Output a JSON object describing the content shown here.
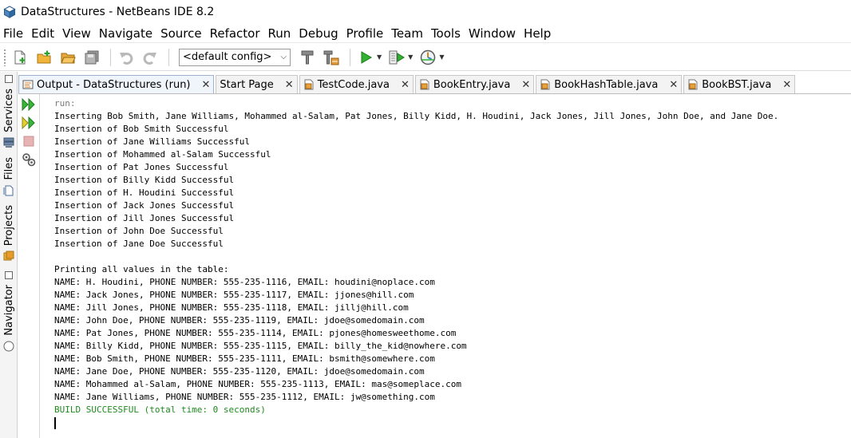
{
  "window": {
    "title": "DataStructures - NetBeans IDE 8.2",
    "app_icon": "netbeans-cube-icon"
  },
  "menubar": {
    "items": [
      "File",
      "Edit",
      "View",
      "Navigate",
      "Source",
      "Refactor",
      "Run",
      "Debug",
      "Profile",
      "Team",
      "Tools",
      "Window",
      "Help"
    ]
  },
  "toolbar": {
    "icons": [
      "new-file-icon",
      "new-project-icon",
      "open-project-icon",
      "save-all-icon",
      "undo-icon",
      "redo-icon",
      "clean-build-icon",
      "build-icon",
      "run-icon",
      "debug-icon",
      "profile-icon"
    ],
    "config_value": "<default config>"
  },
  "left_sidebar": {
    "tabs": [
      "Services",
      "Files",
      "Projects",
      "Navigator"
    ]
  },
  "tabs": [
    {
      "label": "Output - DataStructures (run)",
      "icon": "output-icon",
      "active": true
    },
    {
      "label": "Start Page",
      "icon": "",
      "active": false
    },
    {
      "label": "TestCode.java",
      "icon": "java-file-icon",
      "active": false
    },
    {
      "label": "BookEntry.java",
      "icon": "java-file-icon",
      "active": false
    },
    {
      "label": "BookHashTable.java",
      "icon": "java-file-icon",
      "active": false
    },
    {
      "label": "BookBST.java",
      "icon": "java-file-icon",
      "active": false
    }
  ],
  "output_actions": [
    "rerun-icon",
    "rerun-with-options-icon",
    "stop-icon",
    "settings-icon"
  ],
  "output": {
    "lines": [
      {
        "text": "run:",
        "style": "run"
      },
      {
        "text": "Inserting Bob Smith, Jane Williams, Mohammed al-Salam, Pat Jones, Billy Kidd, H. Houdini, Jack Jones, Jill Jones, John Doe, and Jane Doe.",
        "style": "normal"
      },
      {
        "text": "Insertion of Bob Smith Successful",
        "style": "normal"
      },
      {
        "text": "Insertion of Jane Williams Successful",
        "style": "normal"
      },
      {
        "text": "Insertion of Mohammed al-Salam Successful",
        "style": "normal"
      },
      {
        "text": "Insertion of Pat Jones Successful",
        "style": "normal"
      },
      {
        "text": "Insertion of Billy Kidd Successful",
        "style": "normal"
      },
      {
        "text": "Insertion of H. Houdini Successful",
        "style": "normal"
      },
      {
        "text": "Insertion of Jack Jones Successful",
        "style": "normal"
      },
      {
        "text": "Insertion of Jill Jones Successful",
        "style": "normal"
      },
      {
        "text": "Insertion of John Doe Successful",
        "style": "normal"
      },
      {
        "text": "Insertion of Jane Doe Successful",
        "style": "normal"
      },
      {
        "text": "",
        "style": "normal"
      },
      {
        "text": "Printing all values in the table:",
        "style": "normal"
      },
      {
        "text": "NAME: H. Houdini, PHONE NUMBER: 555-235-1116, EMAIL: houdini@noplace.com",
        "style": "normal"
      },
      {
        "text": "NAME: Jack Jones, PHONE NUMBER: 555-235-1117, EMAIL: jjones@hill.com",
        "style": "normal"
      },
      {
        "text": "NAME: Jill Jones, PHONE NUMBER: 555-235-1118, EMAIL: jillj@hill.com",
        "style": "normal"
      },
      {
        "text": "NAME: John Doe, PHONE NUMBER: 555-235-1119, EMAIL: jdoe@somedomain.com",
        "style": "normal"
      },
      {
        "text": "NAME: Pat Jones, PHONE NUMBER: 555-235-1114, EMAIL: pjones@homesweethome.com",
        "style": "normal"
      },
      {
        "text": "NAME: Billy Kidd, PHONE NUMBER: 555-235-1115, EMAIL: billy_the_kid@nowhere.com",
        "style": "normal"
      },
      {
        "text": "NAME: Bob Smith, PHONE NUMBER: 555-235-1111, EMAIL: bsmith@somewhere.com",
        "style": "normal"
      },
      {
        "text": "NAME: Jane Doe, PHONE NUMBER: 555-235-1120, EMAIL: jdoe@somedomain.com",
        "style": "normal"
      },
      {
        "text": "NAME: Mohammed al-Salam, PHONE NUMBER: 555-235-1113, EMAIL: mas@someplace.com",
        "style": "normal"
      },
      {
        "text": "NAME: Jane Williams, PHONE NUMBER: 555-235-1112, EMAIL: jw@something.com",
        "style": "normal"
      },
      {
        "text": "BUILD SUCCESSFUL (total time: 0 seconds)",
        "style": "success"
      }
    ]
  },
  "colors": {
    "success_text": "#1e8b1e",
    "run_text": "#7a7a7a",
    "active_tab": "#f0f4fb"
  }
}
